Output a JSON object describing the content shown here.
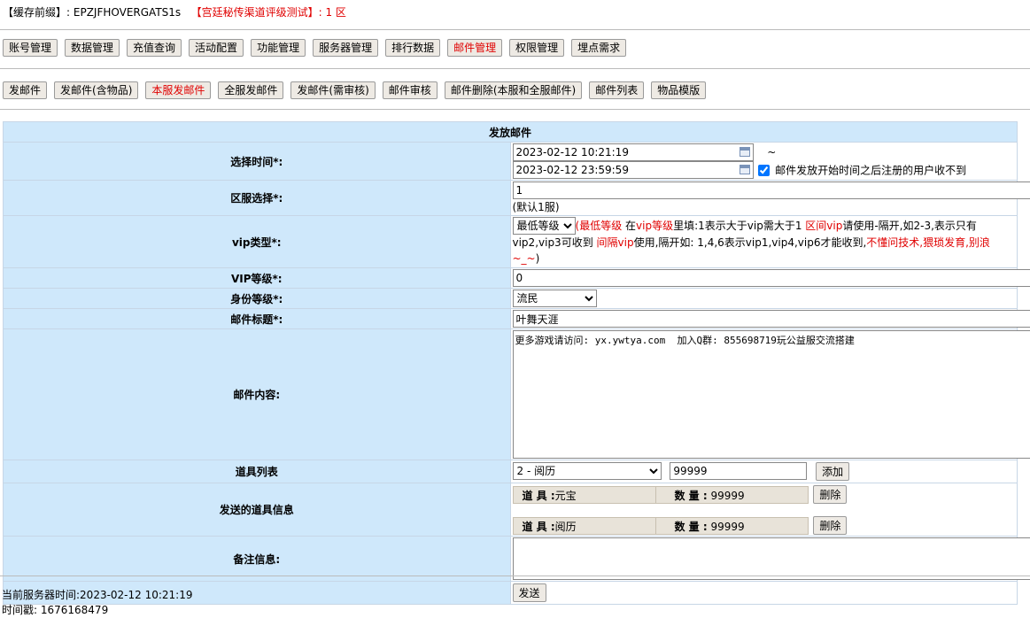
{
  "header": {
    "cache_label": "【缓存前缀】:",
    "cache_value": "EPZJFHOVERGATS1s",
    "server_label": "【宫廷秘传渠道评级测试】: 1 区"
  },
  "main_menu": [
    {
      "label": "账号管理",
      "active": false
    },
    {
      "label": "数据管理",
      "active": false
    },
    {
      "label": "充值查询",
      "active": false
    },
    {
      "label": "活动配置",
      "active": false
    },
    {
      "label": "功能管理",
      "active": false
    },
    {
      "label": "服务器管理",
      "active": false
    },
    {
      "label": "排行数据",
      "active": false
    },
    {
      "label": "邮件管理",
      "active": true
    },
    {
      "label": "权限管理",
      "active": false
    },
    {
      "label": "埋点需求",
      "active": false
    }
  ],
  "sub_menu": [
    {
      "label": "发邮件",
      "active": false
    },
    {
      "label": "发邮件(含物品)",
      "active": false
    },
    {
      "label": "本服发邮件",
      "active": true
    },
    {
      "label": "全服发邮件",
      "active": false
    },
    {
      "label": "发邮件(需审核)",
      "active": false
    },
    {
      "label": "邮件审核",
      "active": false
    },
    {
      "label": "邮件删除(本服和全服邮件)",
      "active": false
    },
    {
      "label": "邮件列表",
      "active": false
    },
    {
      "label": "物品模版",
      "active": false
    }
  ],
  "form": {
    "title": "发放邮件",
    "time_label": "选择时间*:",
    "time_start": "2023-02-12 10:21:19",
    "time_sep": "~",
    "time_end": "2023-02-12 23:59:59",
    "time_check_label": "邮件发放开始时间之后注册的用户收不到",
    "zone_label": "区服选择*:",
    "zone_value": "1",
    "zone_hint": "(默认1服)",
    "vip_type_label": "vip类型*:",
    "vip_type_selected": "最低等级",
    "vip_hint": {
      "p1": "(",
      "p2": "最低等级",
      "p3": " 在",
      "p4": "vip等级",
      "p5": "里填:1表示大于vip需大于1 ",
      "p6": "区间vip",
      "p7": "请使用-隔开,如2-3,表示只有vip2,vip3可收到 ",
      "p8": "间隔vip",
      "p9": "使用,隔开如: 1,4,6表示vip1,vip4,vip6才能收到,",
      "p10": "不懂问技术,猥琐发育,别浪~_~",
      "p11": ")"
    },
    "vip_level_label": "VIP等级*:",
    "vip_level_value": "0",
    "identity_label": "身份等级*:",
    "identity_selected": "流民",
    "subject_label": "邮件标题*:",
    "subject_value": "叶舞天涯",
    "content_label": "邮件内容:",
    "content_value": "更多游戏请访问: yx.ywtya.com  加入Q群: 855698719玩公益服交流搭建",
    "item_list_label": "道具列表",
    "item_selected": "2 - 阅历",
    "item_qty": "99999",
    "add_button": "添加",
    "sent_items_label": "发送的道具信息",
    "sent_items": [
      {
        "item_key": "道 具 :",
        "item_name": "元宝",
        "qty_key": "数 量 :",
        "qty": "99999",
        "delete": "删除"
      },
      {
        "item_key": "道 具 :",
        "item_name": "阅历",
        "qty_key": "数 量 :",
        "qty": "99999",
        "delete": "删除"
      }
    ],
    "remark_label": "备注信息:",
    "remark_value": "",
    "send_button": "发送"
  },
  "footer": {
    "server_time": "当前服务器时间:2023-02-12 10:21:19",
    "timestamp": "时间戳: 1676168479"
  },
  "colors": {
    "label_bg": "#cfe8fb",
    "accent_red": "#e00000",
    "button_bg": "#eeeae4"
  }
}
